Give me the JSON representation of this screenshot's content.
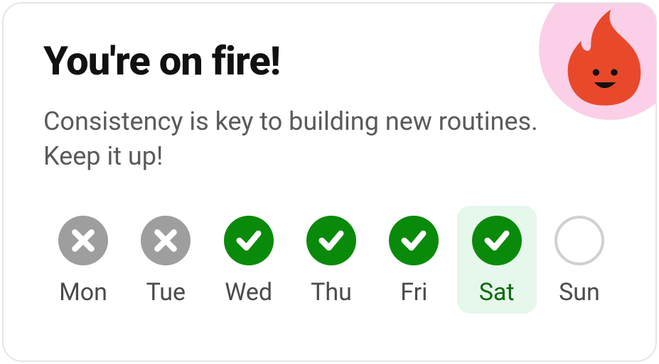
{
  "header": {
    "title": "You're on fire!",
    "subtitle": "Consistency is key to building new routines. Keep it up!",
    "badge_icon": "fire-icon"
  },
  "days": [
    {
      "label": "Mon",
      "status": "missed",
      "today": false
    },
    {
      "label": "Tue",
      "status": "missed",
      "today": false
    },
    {
      "label": "Wed",
      "status": "done",
      "today": false
    },
    {
      "label": "Thu",
      "status": "done",
      "today": false
    },
    {
      "label": "Fri",
      "status": "done",
      "today": false
    },
    {
      "label": "Sat",
      "status": "done",
      "today": true
    },
    {
      "label": "Sun",
      "status": "empty",
      "today": false
    }
  ],
  "colors": {
    "done": "#0a8a0a",
    "missed": "#9e9e9e",
    "today_bg": "#e6f7ec",
    "empty_border": "#d0d0d0",
    "badge_bg": "#fbcfe8",
    "flame": "#e8492b"
  }
}
